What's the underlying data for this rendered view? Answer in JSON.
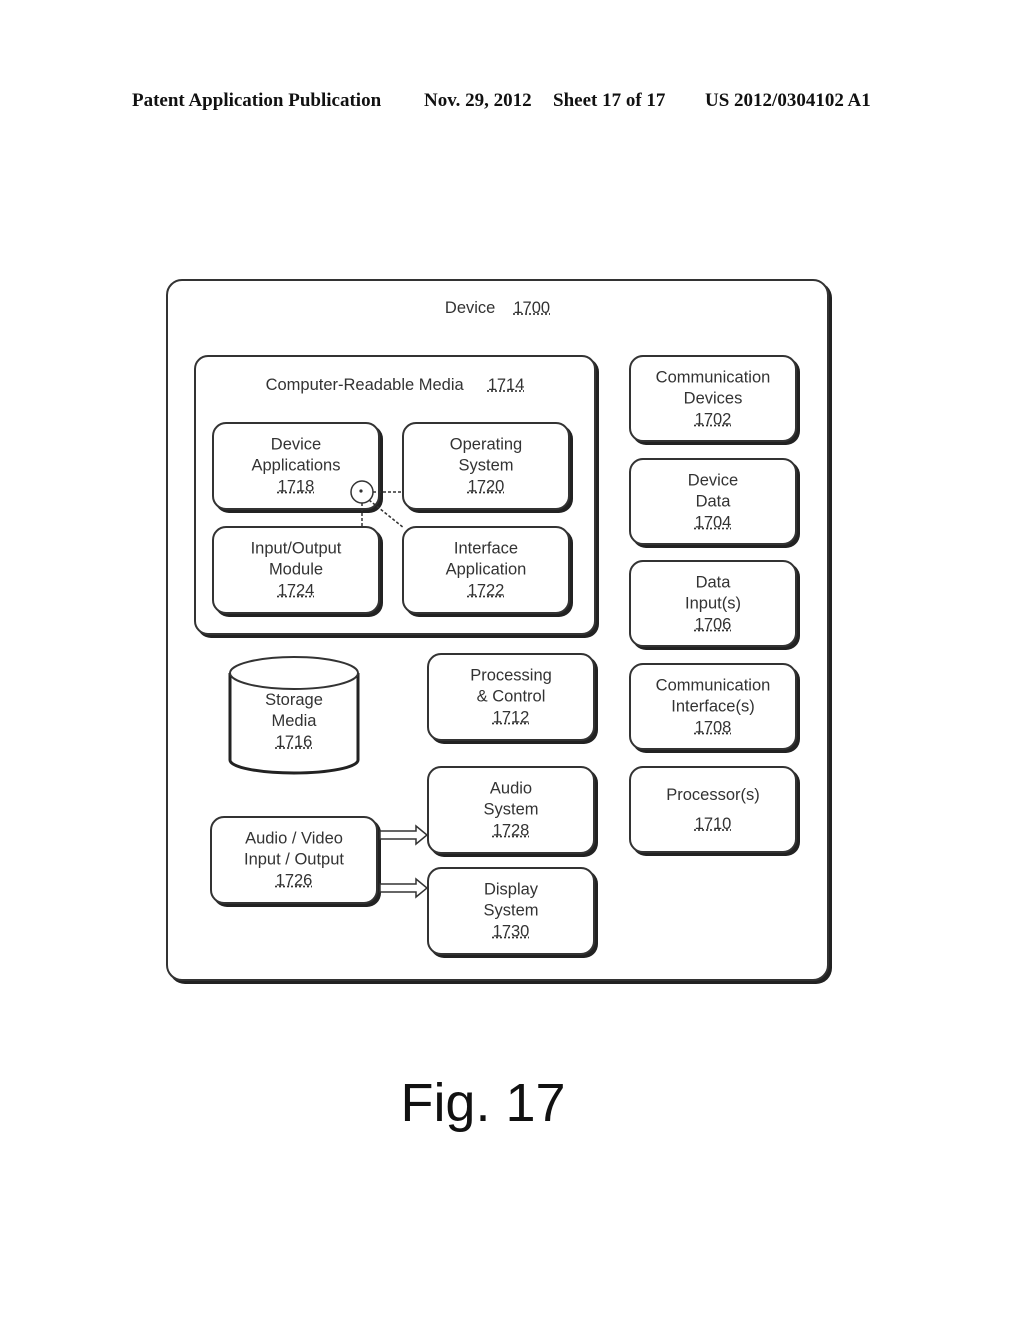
{
  "header": {
    "publication": "Patent Application Publication",
    "date": "Nov. 29, 2012",
    "sheet": "Sheet 17 of 17",
    "patent_number": "US 2012/0304102 A1"
  },
  "device": {
    "label": "Device",
    "number": "1700"
  },
  "computer_readable_media": {
    "label": "Computer-Readable Media",
    "number": "1714",
    "device_applications": {
      "line1": "Device",
      "line2": "Applications",
      "number": "1718"
    },
    "operating_system": {
      "line1": "Operating",
      "line2": "System",
      "number": "1720"
    },
    "input_output_module": {
      "line1": "Input/Output",
      "line2": "Module",
      "number": "1724"
    },
    "interface_application": {
      "line1": "Interface",
      "line2": "Application",
      "number": "1722"
    }
  },
  "storage_media": {
    "line1": "Storage",
    "line2": "Media",
    "number": "1716"
  },
  "processing_control": {
    "line1": "Processing",
    "line2": "& Control",
    "number": "1712"
  },
  "av_io": {
    "line1": "Audio / Video",
    "line2": "Input / Output",
    "number": "1726"
  },
  "audio_system": {
    "line1": "Audio",
    "line2": "System",
    "number": "1728"
  },
  "display_system": {
    "line1": "Display",
    "line2": "System",
    "number": "1730"
  },
  "right_column": {
    "communication_devices": {
      "line1": "Communication",
      "line2": "Devices",
      "number": "1702"
    },
    "device_data": {
      "line1": "Device",
      "line2": "Data",
      "number": "1704"
    },
    "data_inputs": {
      "line1": "Data",
      "line2": "Input(s)",
      "number": "1706"
    },
    "communication_interfaces": {
      "line1": "Communication",
      "line2": "Interface(s)",
      "number": "1708"
    },
    "processors": {
      "line1": "Processor(s)",
      "number": "1710"
    }
  },
  "figure_label": "Fig. 17"
}
